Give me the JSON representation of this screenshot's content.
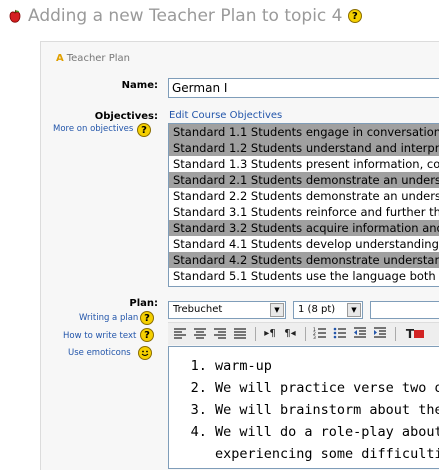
{
  "header": {
    "title": "Adding a new Teacher Plan to topic 4"
  },
  "form": {
    "legend": "Teacher Plan",
    "name_label": "Name:",
    "name_value": "German I",
    "objectives_label": "Objectives:",
    "more_on_objectives": "More on objectives",
    "edit_course_objectives": "Edit Course Objectives",
    "objectives": [
      {
        "text": "Standard 1.1 Students engage in conversations",
        "selected": true
      },
      {
        "text": "Standard 1.2 Students understand and interpret",
        "selected": true
      },
      {
        "text": "Standard 1.3 Students present information, con",
        "selected": false
      },
      {
        "text": "Standard 2.1 Students demonstrate an underst",
        "selected": true
      },
      {
        "text": "Standard 2.2 Students demonstrate an unders",
        "selected": false
      },
      {
        "text": "Standard 3.1 Students reinforce and further the",
        "selected": false
      },
      {
        "text": "Standard 3.2 Students acquire information and",
        "selected": true
      },
      {
        "text": "Standard 4.1 Students develop understanding",
        "selected": false
      },
      {
        "text": "Standard 4.2 Students demonstrate understan",
        "selected": true
      },
      {
        "text": "Standard 5.1 Students use the language both",
        "selected": false
      }
    ],
    "plan_label": "Plan:",
    "writing_a_plan": "Writing a plan",
    "how_to_write_text": "How to write text",
    "use_emoticons": "Use emoticons",
    "font_select": "Trebuchet",
    "size_select": "1 (8 pt)",
    "plan_items": [
      "warm-up",
      "We will practice verse two of",
      "We will brainstorm about the c",
      "We will do a role-play about a"
    ],
    "plan_item4_cont": "experiencing some difficulties."
  },
  "icons": {
    "help": "help-icon",
    "app": "apple-icon",
    "emoticon": "smiley-icon"
  }
}
